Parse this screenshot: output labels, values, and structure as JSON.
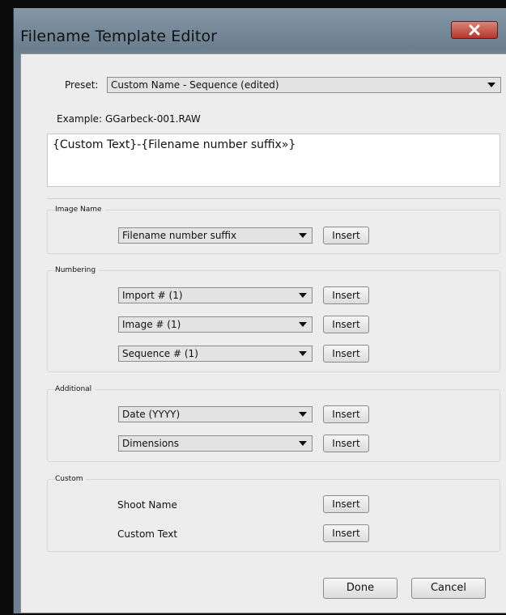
{
  "window": {
    "title": "Filename Template Editor"
  },
  "preset": {
    "label": "Preset:",
    "value": "Custom Name - Sequence (edited)"
  },
  "example": {
    "label": "Example:",
    "value": "GGarbeck-001.RAW"
  },
  "template_text": "{Custom Text}-{Filename number suffix»}",
  "groups": {
    "image_name": {
      "title": "Image Name",
      "rows": [
        {
          "select": "Filename number suffix",
          "button": "Insert"
        }
      ]
    },
    "numbering": {
      "title": "Numbering",
      "rows": [
        {
          "select": "Import # (1)",
          "button": "Insert"
        },
        {
          "select": "Image # (1)",
          "button": "Insert"
        },
        {
          "select": "Sequence # (1)",
          "button": "Insert"
        }
      ]
    },
    "additional": {
      "title": "Additional",
      "rows": [
        {
          "select": "Date (YYYY)",
          "button": "Insert"
        },
        {
          "select": "Dimensions",
          "button": "Insert"
        }
      ]
    },
    "custom": {
      "title": "Custom",
      "rows": [
        {
          "label": "Shoot Name",
          "button": "Insert"
        },
        {
          "label": "Custom Text",
          "button": "Insert"
        }
      ]
    }
  },
  "footer": {
    "done": "Done",
    "cancel": "Cancel"
  },
  "icons": {
    "close": "close-icon",
    "dropdown": "chevron-down-icon"
  }
}
